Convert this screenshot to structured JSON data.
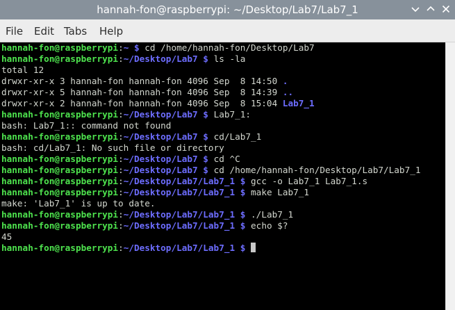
{
  "window": {
    "title": "hannah-fon@raspberrypi: ~/Desktop/Lab7/Lab7_1",
    "buttons": [
      "minimize-icon",
      "maximize-icon",
      "close-icon"
    ]
  },
  "menu": [
    "File",
    "Edit",
    "Tabs",
    "Help"
  ],
  "colors": {
    "user_host": "#4ee44e",
    "path": "#6d6dff",
    "text": "#d3d7cf",
    "background": "#000000",
    "titlebar": "#87919b"
  },
  "terminal": {
    "lines": [
      {
        "kind": "prompt",
        "user": "hannah-fon@raspberrypi",
        "path": "~",
        "cmd": "cd /home/hannah-fon/Desktop/Lab7"
      },
      {
        "kind": "prompt",
        "user": "hannah-fon@raspberrypi",
        "path": "~/Desktop/Lab7",
        "cmd": "ls -la"
      },
      {
        "kind": "out",
        "text": "total 12"
      },
      {
        "kind": "ls",
        "text": "drwxr-xr-x 3 hannah-fon hannah-fon 4096 Sep  8 14:50 ",
        "name": "."
      },
      {
        "kind": "ls",
        "text": "drwxr-xr-x 5 hannah-fon hannah-fon 4096 Sep  8 14:39 ",
        "name": ".."
      },
      {
        "kind": "ls",
        "text": "drwxr-xr-x 2 hannah-fon hannah-fon 4096 Sep  8 15:04 ",
        "name": "Lab7_1"
      },
      {
        "kind": "prompt",
        "user": "hannah-fon@raspberrypi",
        "path": "~/Desktop/Lab7",
        "cmd": "Lab7_1:"
      },
      {
        "kind": "out",
        "text": "bash: Lab7_1:: command not found"
      },
      {
        "kind": "prompt",
        "user": "hannah-fon@raspberrypi",
        "path": "~/Desktop/Lab7",
        "cmd": "cd/Lab7_1"
      },
      {
        "kind": "out",
        "text": "bash: cd/Lab7_1: No such file or directory"
      },
      {
        "kind": "prompt",
        "user": "hannah-fon@raspberrypi",
        "path": "~/Desktop/Lab7",
        "cmd": "cd ^C"
      },
      {
        "kind": "prompt",
        "user": "hannah-fon@raspberrypi",
        "path": "~/Desktop/Lab7",
        "cmd": "cd /home/hannah-fon/Desktop/Lab7/Lab7_1"
      },
      {
        "kind": "prompt",
        "user": "hannah-fon@raspberrypi",
        "path": "~/Desktop/Lab7/Lab7_1",
        "cmd": "gcc -o Lab7_1 Lab7_1.s"
      },
      {
        "kind": "prompt",
        "user": "hannah-fon@raspberrypi",
        "path": "~/Desktop/Lab7/Lab7_1",
        "cmd": "make Lab7_1"
      },
      {
        "kind": "out",
        "text": "make: 'Lab7_1' is up to date."
      },
      {
        "kind": "prompt",
        "user": "hannah-fon@raspberrypi",
        "path": "~/Desktop/Lab7/Lab7_1",
        "cmd": "./Lab7_1"
      },
      {
        "kind": "prompt",
        "user": "hannah-fon@raspberrypi",
        "path": "~/Desktop/Lab7/Lab7_1",
        "cmd": "echo $?"
      },
      {
        "kind": "out",
        "text": "45"
      },
      {
        "kind": "prompt",
        "user": "hannah-fon@raspberrypi",
        "path": "~/Desktop/Lab7/Lab7_1",
        "cmd": "",
        "cursor": true
      }
    ]
  }
}
